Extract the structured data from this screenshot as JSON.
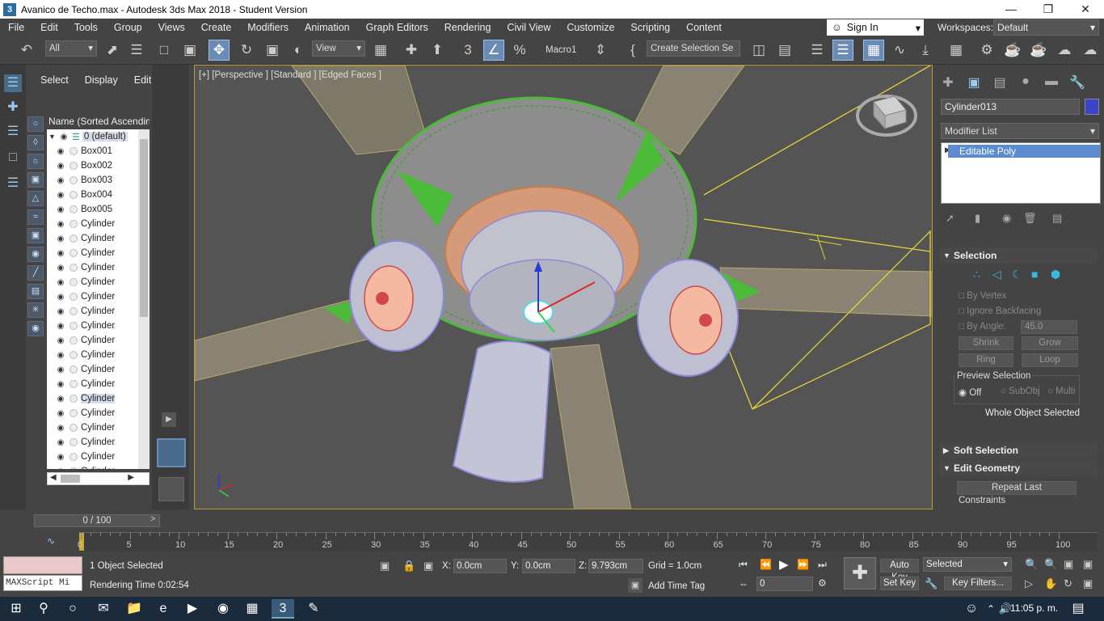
{
  "window": {
    "title": "Avanico de Techo.max - Autodesk 3ds Max 2018 - Student Version",
    "app_icon": "3"
  },
  "menu": [
    "File",
    "Edit",
    "Tools",
    "Group",
    "Views",
    "Create",
    "Modifiers",
    "Animation",
    "Graph Editors",
    "Rendering",
    "Civil View",
    "Customize",
    "Scripting",
    "Content"
  ],
  "signin": {
    "label": "Sign In"
  },
  "workspaces": {
    "label": "Workspaces:",
    "value": "Default"
  },
  "toolbar": {
    "filter": "All",
    "refcoord": "View",
    "macro": "Macro1",
    "selset": "Create Selection Se"
  },
  "explorer": {
    "tabs": [
      "Select",
      "Display",
      "Edit"
    ],
    "column_header": "Name (Sorted Ascending)",
    "layer": "0 (default)",
    "items": [
      {
        "name": "Box001"
      },
      {
        "name": "Box002"
      },
      {
        "name": "Box003"
      },
      {
        "name": "Box004"
      },
      {
        "name": "Box005"
      },
      {
        "name": "Cylinder"
      },
      {
        "name": "Cylinder"
      },
      {
        "name": "Cylinder"
      },
      {
        "name": "Cylinder"
      },
      {
        "name": "Cylinder"
      },
      {
        "name": "Cylinder"
      },
      {
        "name": "Cylinder"
      },
      {
        "name": "Cylinder"
      },
      {
        "name": "Cylinder"
      },
      {
        "name": "Cylinder"
      },
      {
        "name": "Cylinder"
      },
      {
        "name": "Cylinder"
      },
      {
        "name": "Cylinder"
      },
      {
        "name": "Cylinder"
      },
      {
        "name": "Cylinder"
      },
      {
        "name": "Cylinder"
      },
      {
        "name": "Cylinder"
      },
      {
        "name": "Cylinder"
      },
      {
        "name": "Cylinder"
      }
    ]
  },
  "viewport": {
    "label": "[+] [Perspective ] [Standard ] [Edged Faces ]"
  },
  "command_panel": {
    "object_name": "Cylinder013",
    "object_color": "#3a44c8",
    "modifier_list": "Modifier List",
    "stack_item": "Editable Poly",
    "selection": {
      "title": "Selection",
      "by_vertex": "By Vertex",
      "ignore_backfacing": "Ignore Backfacing",
      "by_angle": "By Angle:",
      "angle_value": "45.0",
      "shrink": "Shrink",
      "grow": "Grow",
      "ring": "Ring",
      "loop": "Loop",
      "preview_title": "Preview Selection",
      "preview_off": "Off",
      "preview_subobj": "SubObj",
      "preview_multi": "Multi",
      "status": "Whole Object Selected"
    },
    "soft_selection": "Soft Selection",
    "edit_geometry": "Edit Geometry",
    "repeat_last": "Repeat Last",
    "constraints": "Constraints"
  },
  "timeline": {
    "frame_display": "0 / 100",
    "ticks": [
      "0",
      "5",
      "10",
      "15",
      "20",
      "25",
      "30",
      "35",
      "40",
      "45",
      "50",
      "55",
      "60",
      "65",
      "70",
      "75",
      "80",
      "85",
      "90",
      "95",
      "100"
    ]
  },
  "status": {
    "maxscript": "MAXScript Mi",
    "objects_selected": "1 Object Selected",
    "render_time": "Rendering Time  0:02:54",
    "x_label": "X:",
    "x_value": "0.0cm",
    "y_label": "Y:",
    "y_value": "0.0cm",
    "z_label": "Z:",
    "z_value": "9.793cm",
    "grid": "Grid = 1.0cm",
    "add_time_tag": "Add Time Tag",
    "auto_key": "Auto Key",
    "set_key": "Set Key",
    "selected": "Selected",
    "key_filters": "Key Filters...",
    "frame": "0"
  },
  "taskbar": {
    "clock": "11:05 p. m."
  }
}
